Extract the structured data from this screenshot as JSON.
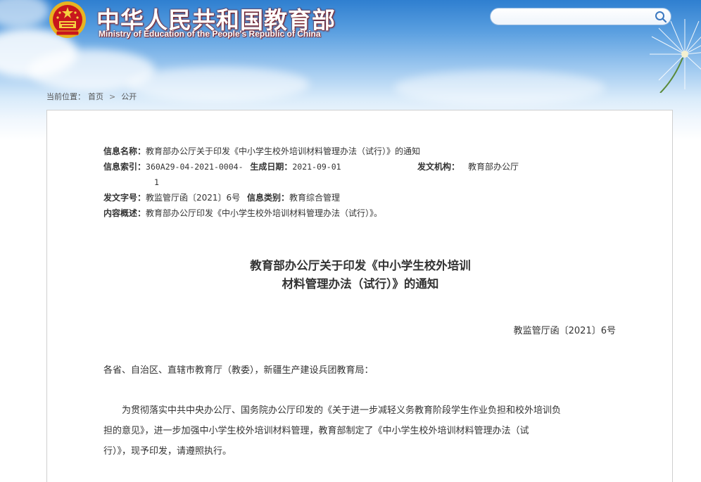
{
  "header": {
    "site_title": "中华人民共和国教育部",
    "site_subtitle": "Ministry of Education of the People's Republic of China",
    "emblem_icon": "national-emblem-icon"
  },
  "search": {
    "value": "",
    "placeholder": "",
    "button_icon": "search-icon"
  },
  "breadcrumb": {
    "label": "当前位置：",
    "home": "首页",
    "separator": ">",
    "current": "公开"
  },
  "meta": {
    "name_label": "信息名称：",
    "name_value": "教育部办公厅关于印发《中小学生校外培训材料管理办法（试行）》的通知",
    "index_label": "信息索引：",
    "index_value_line1": "360A29-04-2021-0004-",
    "index_value_line2": "1",
    "date_label": "生成日期：",
    "date_value": "2021-09-01",
    "issuer_label": "发文机构：",
    "issuer_value": "教育部办公厅",
    "docno_label": "发文字号：",
    "docno_value": "教监管厅函〔2021〕6号",
    "category_label": "信息类别：",
    "category_value": "教育综合管理",
    "summary_label": "内容概述：",
    "summary_value": "教育部办公厅印发《中小学生校外培训材料管理办法（试行）》。"
  },
  "document": {
    "title_line1": "教育部办公厅关于印发《中小学生校外培训",
    "title_line2": "材料管理办法（试行）》的通知",
    "doc_number": "教监管厅函〔2021〕6号",
    "addressee": "各省、自治区、直辖市教育厅（教委），新疆生产建设兵团教育局：",
    "body_line1": "　　为贯彻落实中共中央办公厅、国务院办公厅印发的《关于进一步减轻义务教育阶段学生作业负担和校外培训负",
    "body_line2": "担的意见》，进一步加强中小学生校外培训材料管理，教育部制定了《中小学生校外培训材料管理办法（试",
    "body_line3": "行）》，现予印发，请遵照执行。"
  },
  "colors": {
    "banner_blue": "#2f7fd0",
    "title_shadow": "#8a1a1a",
    "text": "#333333",
    "panel_border": "#cfcfcf"
  }
}
